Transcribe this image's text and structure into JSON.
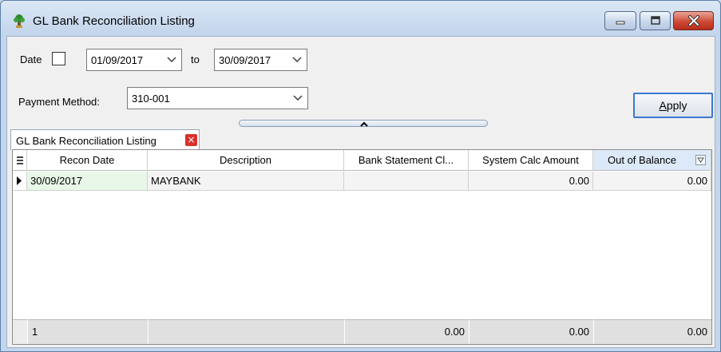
{
  "window": {
    "title": "GL Bank Reconciliation Listing",
    "icon": "app-shrub-icon"
  },
  "filters": {
    "date_label": "Date",
    "date_checked": false,
    "from_date": "01/09/2017",
    "to_label": "to",
    "to_date": "30/09/2017",
    "payment_method_label": "Payment Method:",
    "payment_method": "310-001",
    "apply_underlined": "A",
    "apply_rest": "pply"
  },
  "tab": {
    "label": "GL Bank Reconciliation Listing",
    "close_glyph": "×"
  },
  "grid": {
    "columns": [
      {
        "label": "Recon Date"
      },
      {
        "label": "Description"
      },
      {
        "label": "Bank Statement Cl..."
      },
      {
        "label": "System Calc Amount"
      },
      {
        "label": "Out of Balance"
      }
    ],
    "rows": [
      {
        "recon_date": "30/09/2017",
        "description": "MAYBANK",
        "bank_statement": "",
        "system_calc": "0.00",
        "out_of_balance": "0.00"
      }
    ],
    "footer": {
      "count": "1",
      "bank_statement": "0.00",
      "system_calc": "0.00",
      "out_of_balance": "0.00"
    }
  },
  "colors": {
    "close_button": "#cd4a36",
    "apply_border": "#3b79d1",
    "active_header": "#dce9f8",
    "selected_cell": "#e8f7e8"
  }
}
